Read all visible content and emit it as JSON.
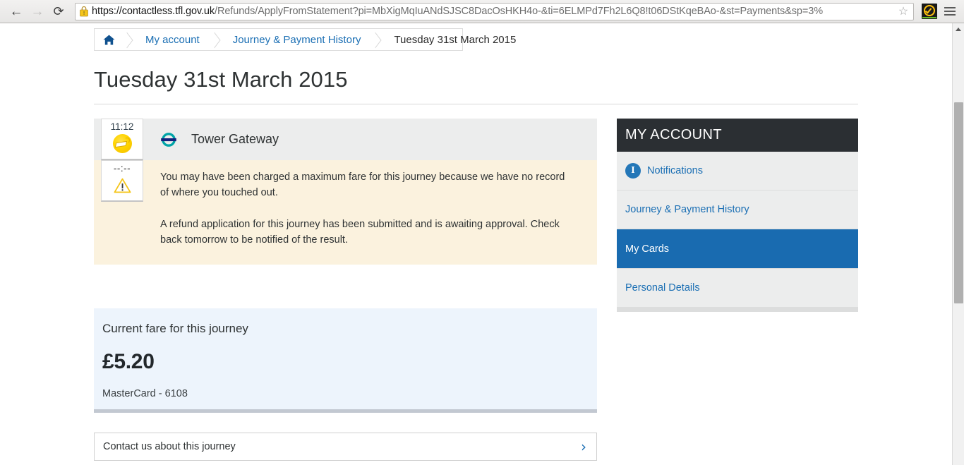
{
  "browser": {
    "back_label": "←",
    "forward_label": "→",
    "reload_label": "⟳",
    "url_host": "https://contactless.tfl.gov.uk",
    "url_path": "/Refunds/ApplyFromStatement?pi=MbXigMqIuANdSJSC8DacOsHKH4o-&ti=6ELMPd7Fh2L6Q8!t06DStKqeBAo-&st=Payments&sp=3%",
    "star_label": "☆",
    "lock_icon_name": "insecure-https-lock",
    "extension_icon_name": "adblock-checkmark",
    "menu_icon_name": "hamburger-menu"
  },
  "breadcrumb": {
    "home_glyph": "⌂",
    "items": [
      {
        "label": "My account",
        "current": false
      },
      {
        "label": "Journey & Payment History",
        "current": false
      },
      {
        "label": "Tuesday 31st March 2015",
        "current": true
      }
    ]
  },
  "page": {
    "title": "Tuesday 31st March 2015"
  },
  "journey": {
    "touch_in": {
      "time": "11:12",
      "icon_name": "contactless-touch-in-icon",
      "mode_icon_name": "dlr-roundel-icon",
      "station": "Tower Gateway"
    },
    "touch_out": {
      "time": "--:--",
      "icon_name": "warning-triangle-icon",
      "messages": [
        "You may have been charged a maximum fare for this journey because we have no record of where you touched out.",
        "A refund application for this journey has been submitted and is awaiting approval. Check back tomorrow to be notified of the result."
      ]
    }
  },
  "fare": {
    "title": "Current fare for this journey",
    "amount": "£5.20",
    "card": "MasterCard - 6108"
  },
  "contact": {
    "label": "Contact us about this journey",
    "chevron": "›"
  },
  "sidebar": {
    "title": "MY ACCOUNT",
    "items": [
      {
        "label": "Notifications",
        "icon": "info-icon",
        "active": false
      },
      {
        "label": "Journey & Payment History",
        "icon": "",
        "active": false
      },
      {
        "label": "My Cards",
        "icon": "",
        "active": true
      },
      {
        "label": "Personal Details",
        "icon": "",
        "active": false
      }
    ],
    "notification_glyph": "I"
  },
  "colors": {
    "tfl_blue": "#1b6fb4",
    "active_blue": "#196bb0",
    "dark_header": "#2b2f33",
    "warning_bg": "#fbf2de",
    "fare_bg": "#edf4fc",
    "touch_yellow": "#ffd400",
    "dlr_teal": "#00a4a7",
    "dlr_navy": "#11217e"
  }
}
